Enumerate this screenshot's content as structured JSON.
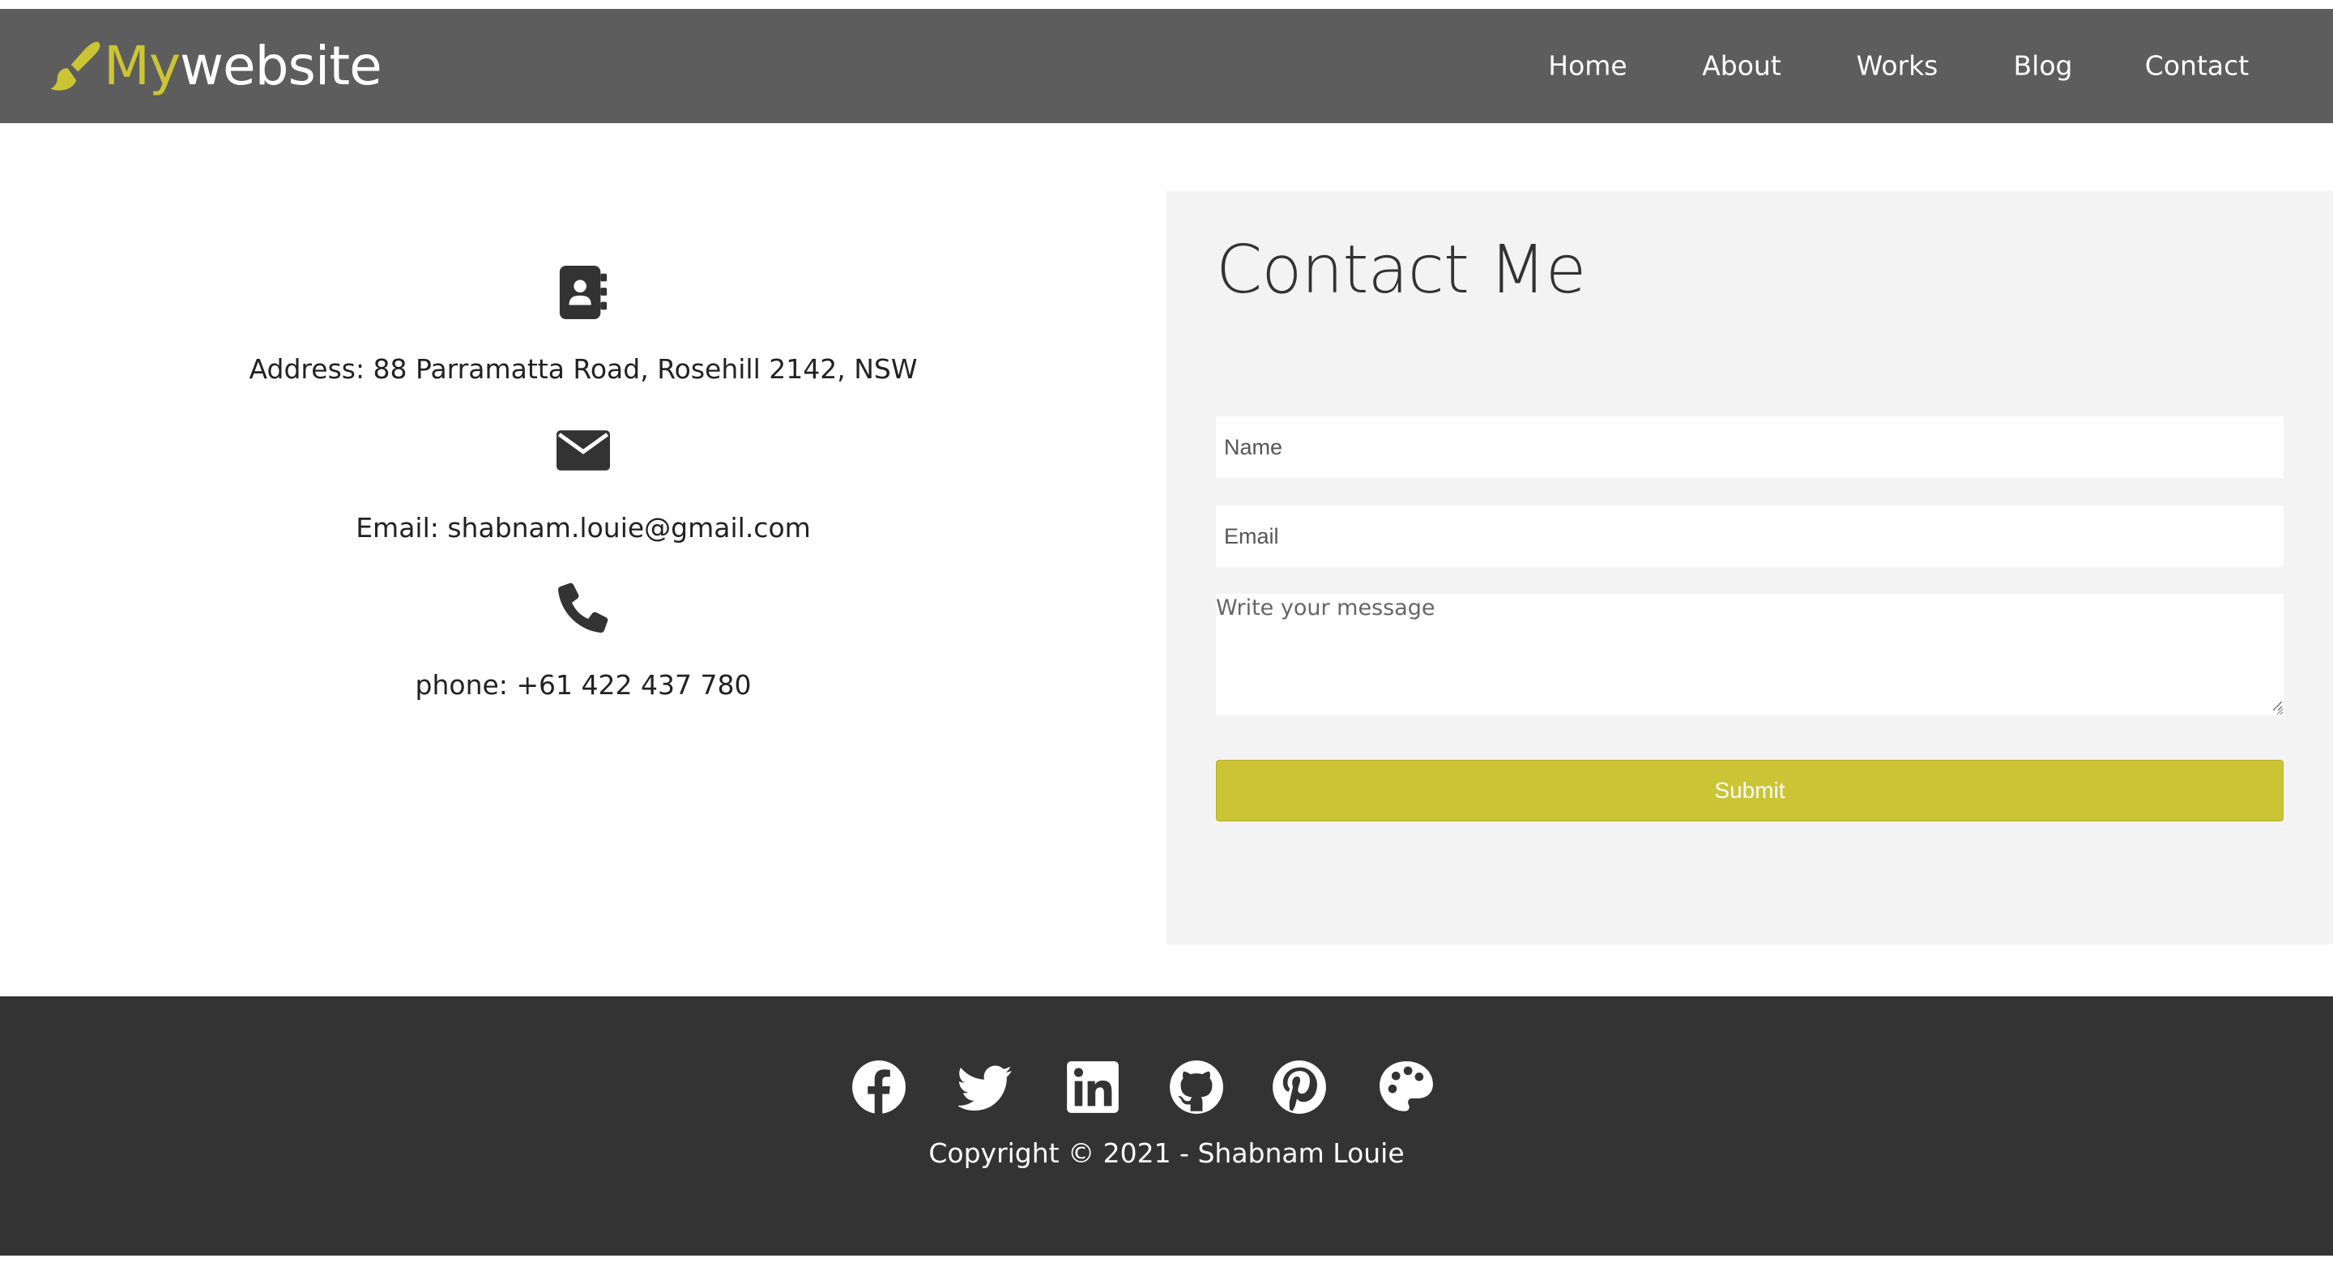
{
  "navbar": {
    "brand_prefix": "My",
    "brand_suffix": "website",
    "brand_icon": "paint-brush-icon",
    "links": [
      "Home",
      "About",
      "Works",
      "Blog",
      "Contact"
    ]
  },
  "contact_info": {
    "address": "Address: 88 Parramatta Road, Rosehill 2142, NSW",
    "email": "Email: shabnam.louie@gmail.com",
    "phone": "phone: +61 422 437 780",
    "icons": [
      "address-book-icon",
      "envelope-icon",
      "phone-icon"
    ]
  },
  "form": {
    "title": "Contact Me",
    "name_placeholder": "Name",
    "email_placeholder": "Email",
    "message_placeholder": "Write your message",
    "submit_label": "Submit"
  },
  "footer": {
    "social_icons": [
      "facebook-icon",
      "twitter-icon",
      "linkedin-icon",
      "github-icon",
      "pinterest-icon",
      "palette-icon"
    ],
    "copyright": "Copyright © 2021 - Shabnam Louie"
  },
  "colors": {
    "accent": "#cbc434",
    "navbar_bg": "#5d5d5d",
    "footer_bg": "#333333",
    "panel_bg": "#f3f3f3"
  }
}
